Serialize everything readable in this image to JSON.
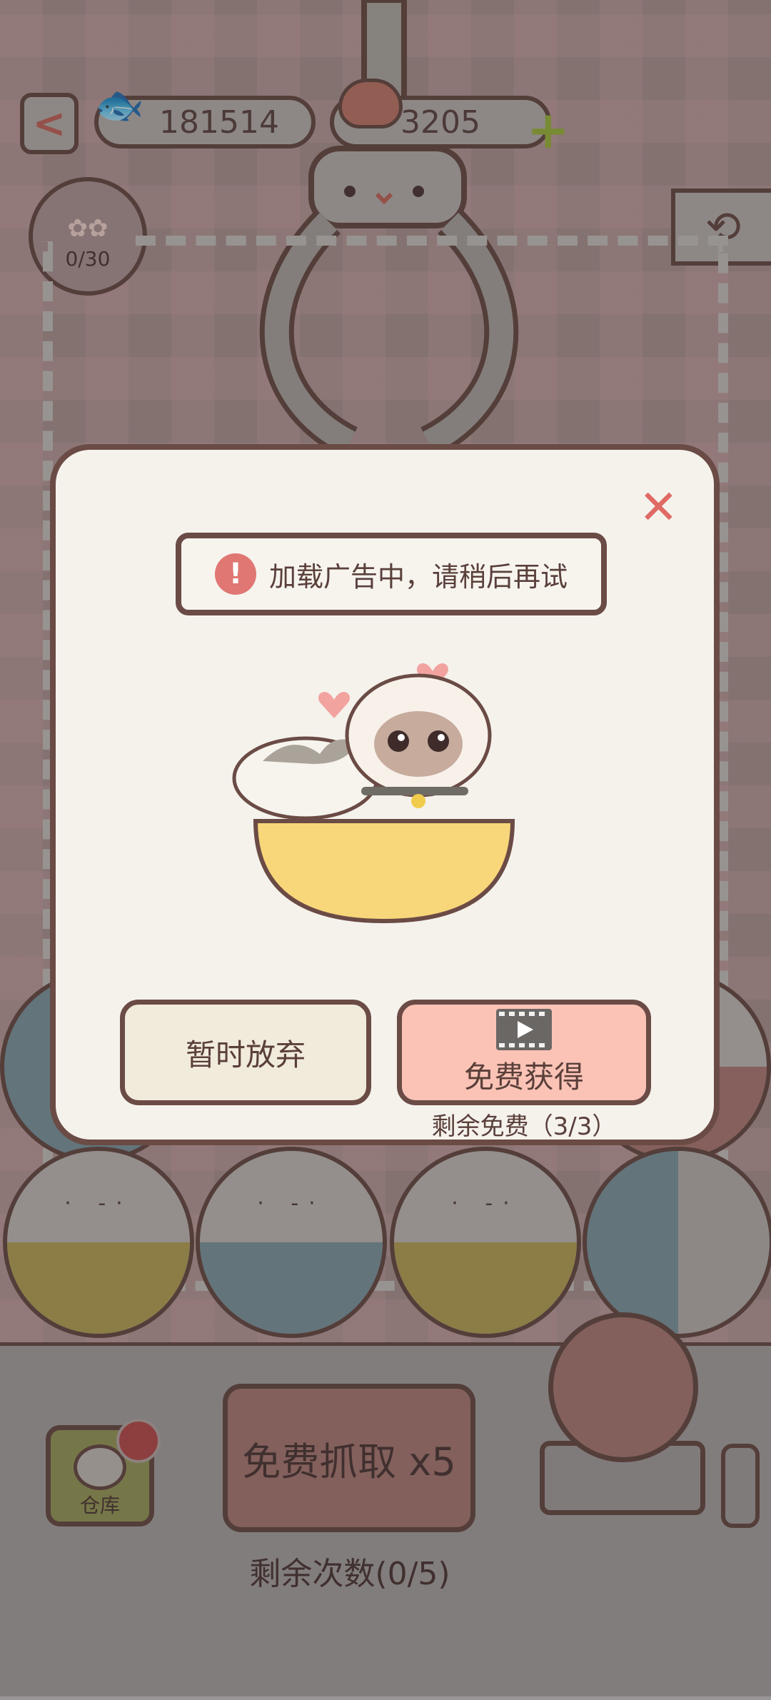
{
  "header": {
    "fish_count": "181514",
    "heart_count": "3205",
    "collection_counter": "0/30"
  },
  "dialog": {
    "toast_text": "加载广告中，请稍后再试",
    "cancel_label": "暂时放弃",
    "free_label": "免费获得",
    "free_remaining": "剩余免费（3/3）"
  },
  "bottom": {
    "grab_label": "免费抓取 x5",
    "remaining_label": "剩余次数(0/5)",
    "storage_label": "仓库"
  },
  "colors": {
    "accent_red": "#e06a64",
    "free_button": "#fbc3b6",
    "cancel_button": "#f1ebdc",
    "outline": "#5b3f3a"
  }
}
